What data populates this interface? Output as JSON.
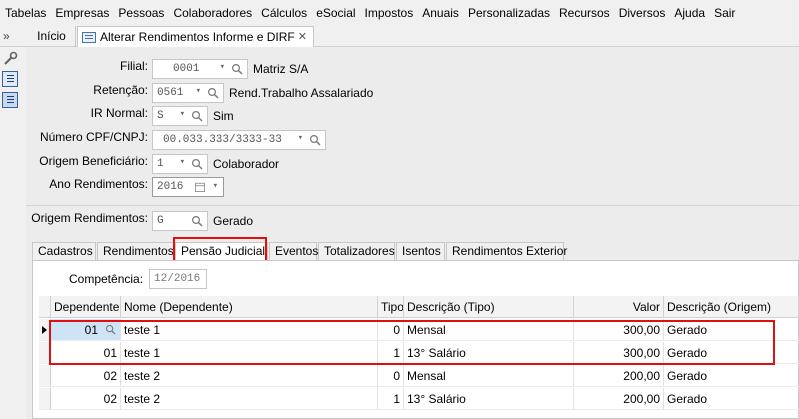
{
  "menu": [
    "Tabelas",
    "Empresas",
    "Pessoas",
    "Colaboradores",
    "Cálculos",
    "eSocial",
    "Impostos",
    "Anuais",
    "Personalizadas",
    "Recursos",
    "Diversos",
    "Ajuda",
    "Sair"
  ],
  "collapse_label": "»",
  "tabs": {
    "home": "Início",
    "active": "Alterar Rendimentos Informe e DIRF",
    "close": "✕"
  },
  "form": {
    "filial": {
      "label": "Filial:",
      "value": "0001",
      "desc": "Matriz S/A"
    },
    "retencao": {
      "label": "Retenção:",
      "value": "0561",
      "desc": "Rend.Trabalho Assalariado"
    },
    "ir_normal": {
      "label": "IR Normal:",
      "value": "S",
      "desc": "Sim"
    },
    "cpf_cnpj": {
      "label": "Número CPF/CNPJ:",
      "value": "00.033.333/3333-33",
      "desc": ""
    },
    "origem_benef": {
      "label": "Origem Beneficiário:",
      "value": "1",
      "desc": "Colaborador"
    },
    "ano": {
      "label": "Ano Rendimentos:",
      "value": "2016"
    },
    "origem_rend": {
      "label": "Origem Rendimentos:",
      "value": "G",
      "desc": "Gerado"
    }
  },
  "inner_tabs": [
    "Cadastros",
    "Rendimentos",
    "Pensão Judicial",
    "Eventos",
    "Totalizadores",
    "Isentos",
    "Rendimentos Exterior"
  ],
  "selected_inner_tab": "Pensão Judicial",
  "competencia": {
    "label": "Competência:",
    "value": "12/2016"
  },
  "grid": {
    "headers": [
      "Dependente",
      "Nome (Dependente)",
      "Tipo",
      "Descrição (Tipo)",
      "Valor",
      "Descrição (Origem)"
    ],
    "rows": [
      [
        "01",
        "teste 1",
        "0",
        "Mensal",
        "300,00",
        "Gerado"
      ],
      [
        "01",
        "teste 1",
        "1",
        "13° Salário",
        "300,00",
        "Gerado"
      ],
      [
        "02",
        "teste 2",
        "0",
        "Mensal",
        "200,00",
        "Gerado"
      ],
      [
        "02",
        "teste 2",
        "1",
        "13° Salário",
        "200,00",
        "Gerado"
      ]
    ]
  },
  "colors": {
    "highlight_border": "#e01010",
    "selected_cell": "#cfe3f7"
  }
}
